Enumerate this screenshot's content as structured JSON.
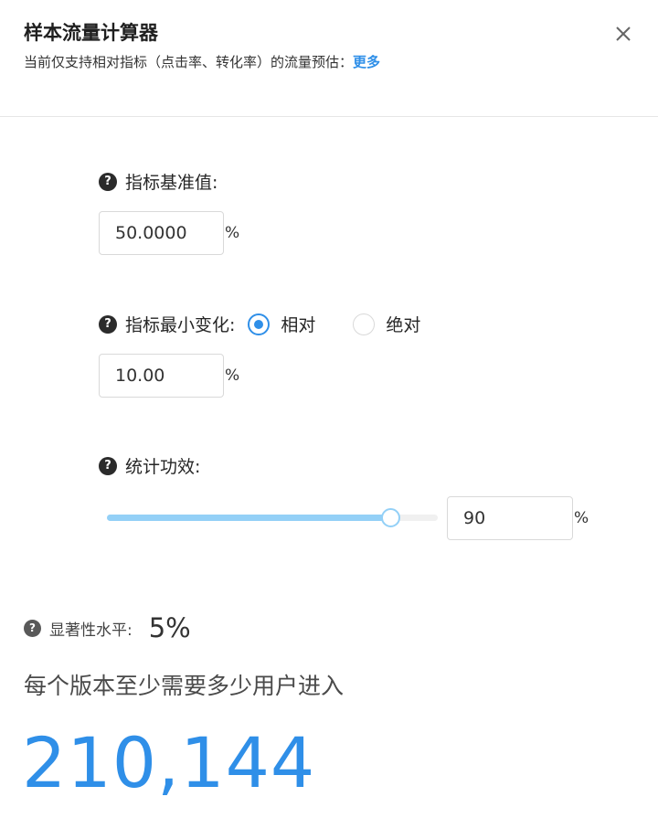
{
  "header": {
    "title": "样本流量计算器",
    "subtitle": "当前仅支持相对指标（点击率、转化率）的流量预估：",
    "more_link": "更多",
    "close_icon": "close-icon"
  },
  "baseline": {
    "label": "指标基准值:",
    "value": "50.0000",
    "unit": "%"
  },
  "min_change": {
    "label": "指标最小变化:",
    "options": [
      {
        "label": "相对",
        "checked": true
      },
      {
        "label": "绝对",
        "checked": false
      }
    ],
    "value": "10.00",
    "unit": "%"
  },
  "power": {
    "label": "统计功效:",
    "slider_value": 90,
    "value": "90",
    "unit": "%"
  },
  "significance": {
    "label": "显著性水平:",
    "value": "5%"
  },
  "result": {
    "label": "每个版本至少需要多少用户进入",
    "value": "210,144"
  },
  "colors": {
    "accent": "#2f8fe8",
    "slider": "#93d0f7"
  }
}
